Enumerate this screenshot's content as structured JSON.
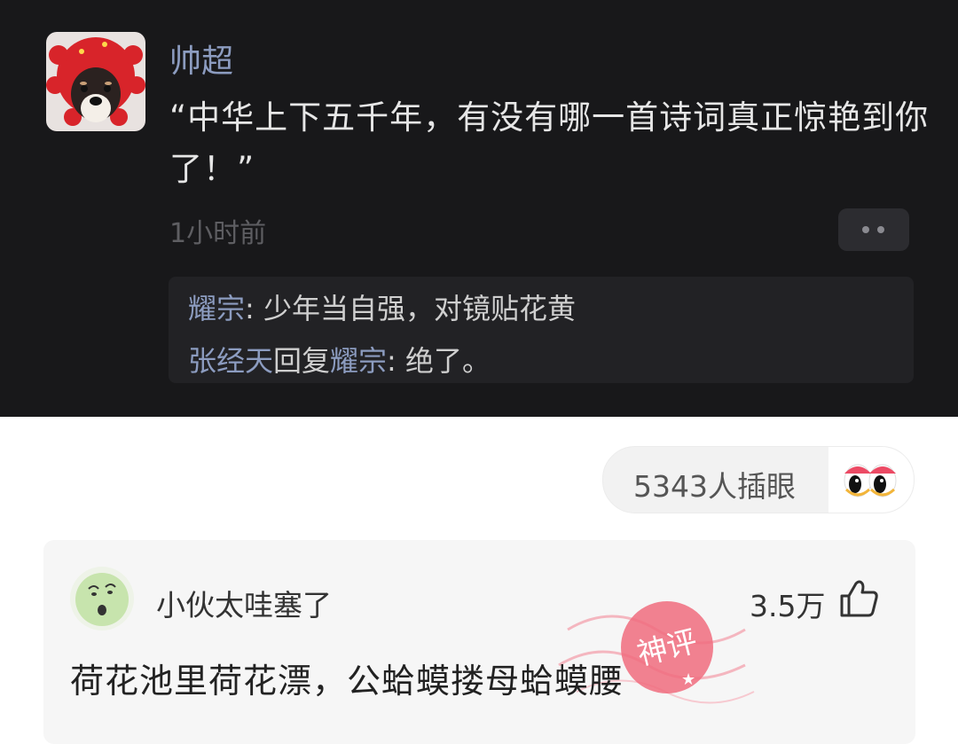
{
  "post": {
    "username": "帅超",
    "text": "“中华上下五千年，有没有哪一首诗词真正惊艳到你了！”",
    "time": "1小时前",
    "replies": [
      {
        "name": "耀宗",
        "sep": ": ",
        "text": "少年当自强，对镜贴花黄"
      },
      {
        "name": "张经天",
        "mid": "回复",
        "name2": "耀宗",
        "sep": ": ",
        "text": "绝了。"
      }
    ]
  },
  "reaction": {
    "count_label": "5343人插眼",
    "icon": "eyes-icon"
  },
  "comment": {
    "username": "小伙太哇塞了",
    "likes": "3.5万",
    "text": "荷花池里荷花漂，公蛤蟆搂母蛤蟆腰",
    "stamp": "神评"
  },
  "colors": {
    "dark_bg": "#18181a",
    "name_blue": "#8c9cc0",
    "stamp_red": "#e85a6a"
  }
}
